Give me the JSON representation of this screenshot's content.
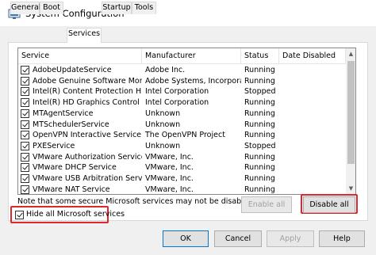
{
  "window": {
    "title": "System Configuration",
    "icon": "msconfig-icon"
  },
  "tabs": [
    {
      "label": "General",
      "active": false
    },
    {
      "label": "Boot",
      "active": false
    },
    {
      "label": "Services",
      "active": true
    },
    {
      "label": "Startup",
      "active": false
    },
    {
      "label": "Tools",
      "active": false
    }
  ],
  "services_table": {
    "columns": [
      "Service",
      "Manufacturer",
      "Status",
      "Date Disabled"
    ],
    "rows": [
      {
        "checked": true,
        "service": "AdobeUpdateService",
        "manufacturer": "Adobe Inc.",
        "status": "Running",
        "date_disabled": ""
      },
      {
        "checked": true,
        "service": "Adobe Genuine Software Monito...",
        "manufacturer": "Adobe Systems, Incorpora...",
        "status": "Running",
        "date_disabled": ""
      },
      {
        "checked": true,
        "service": "Intel(R) Content Protection HEC...",
        "manufacturer": "Intel Corporation",
        "status": "Stopped",
        "date_disabled": ""
      },
      {
        "checked": true,
        "service": "Intel(R) HD Graphics Control Pa...",
        "manufacturer": "Intel Corporation",
        "status": "Running",
        "date_disabled": ""
      },
      {
        "checked": true,
        "service": "MTAgentService",
        "manufacturer": "Unknown",
        "status": "Running",
        "date_disabled": ""
      },
      {
        "checked": true,
        "service": "MTSchedulerService",
        "manufacturer": "Unknown",
        "status": "Running",
        "date_disabled": ""
      },
      {
        "checked": true,
        "service": "OpenVPN Interactive Service",
        "manufacturer": "The OpenVPN Project",
        "status": "Running",
        "date_disabled": ""
      },
      {
        "checked": true,
        "service": "PXEService",
        "manufacturer": "Unknown",
        "status": "Stopped",
        "date_disabled": ""
      },
      {
        "checked": true,
        "service": "VMware Authorization Service",
        "manufacturer": "VMware, Inc.",
        "status": "Running",
        "date_disabled": ""
      },
      {
        "checked": true,
        "service": "VMware DHCP Service",
        "manufacturer": "VMware, Inc.",
        "status": "Running",
        "date_disabled": ""
      },
      {
        "checked": true,
        "service": "VMware USB Arbitration Service",
        "manufacturer": "VMware, Inc.",
        "status": "Running",
        "date_disabled": ""
      },
      {
        "checked": true,
        "service": "VMware NAT Service",
        "manufacturer": "VMware, Inc.",
        "status": "Running",
        "date_disabled": ""
      }
    ]
  },
  "note": "Note that some secure Microsoft services may not be disabled.",
  "buttons": {
    "enable_all": "Enable all",
    "disable_all": "Disable all",
    "ok": "OK",
    "cancel": "Cancel",
    "apply": "Apply",
    "help": "Help"
  },
  "hide_ms_services": {
    "label": "Hide all Microsoft services",
    "checked": true
  },
  "colors": {
    "highlight": "#e0262a",
    "window_bg": "#f0f0f0",
    "panel_bg": "#ffffff"
  }
}
